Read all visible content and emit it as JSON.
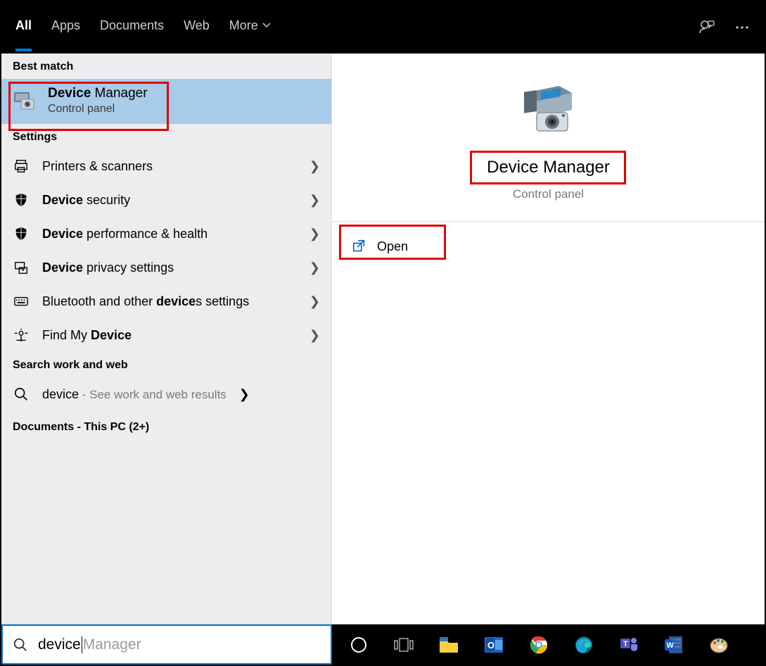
{
  "tabs": {
    "all": "All",
    "apps": "Apps",
    "documents": "Documents",
    "web": "Web",
    "more": "More"
  },
  "left": {
    "best_match_label": "Best match",
    "best_match": {
      "title_bold": "Device",
      "title_rest": " Manager",
      "subtitle": "Control panel"
    },
    "settings_label": "Settings",
    "settings": [
      {
        "icon": "printer",
        "pre": "",
        "bold": "",
        "post": "Printers & scanners"
      },
      {
        "icon": "shield",
        "pre": "",
        "bold": "Device",
        "post": " security"
      },
      {
        "icon": "shield",
        "pre": "",
        "bold": "Device",
        "post": " performance & health"
      },
      {
        "icon": "privacy",
        "pre": "",
        "bold": "Device",
        "post": " privacy settings"
      },
      {
        "icon": "bluetooth",
        "pre": "Bluetooth and other ",
        "bold": "device",
        "post": "s settings"
      },
      {
        "icon": "findmy",
        "pre": "Find My ",
        "bold": "Device",
        "post": ""
      }
    ],
    "search_web_label": "Search work and web",
    "search_web": {
      "term": "device",
      "suffix": " - See work and web results"
    },
    "documents_label": "Documents - This PC (2+)"
  },
  "right": {
    "title": "Device Manager",
    "subtitle": "Control panel",
    "open": "Open"
  },
  "search": {
    "typed": "device",
    "ghost": " Manager"
  }
}
